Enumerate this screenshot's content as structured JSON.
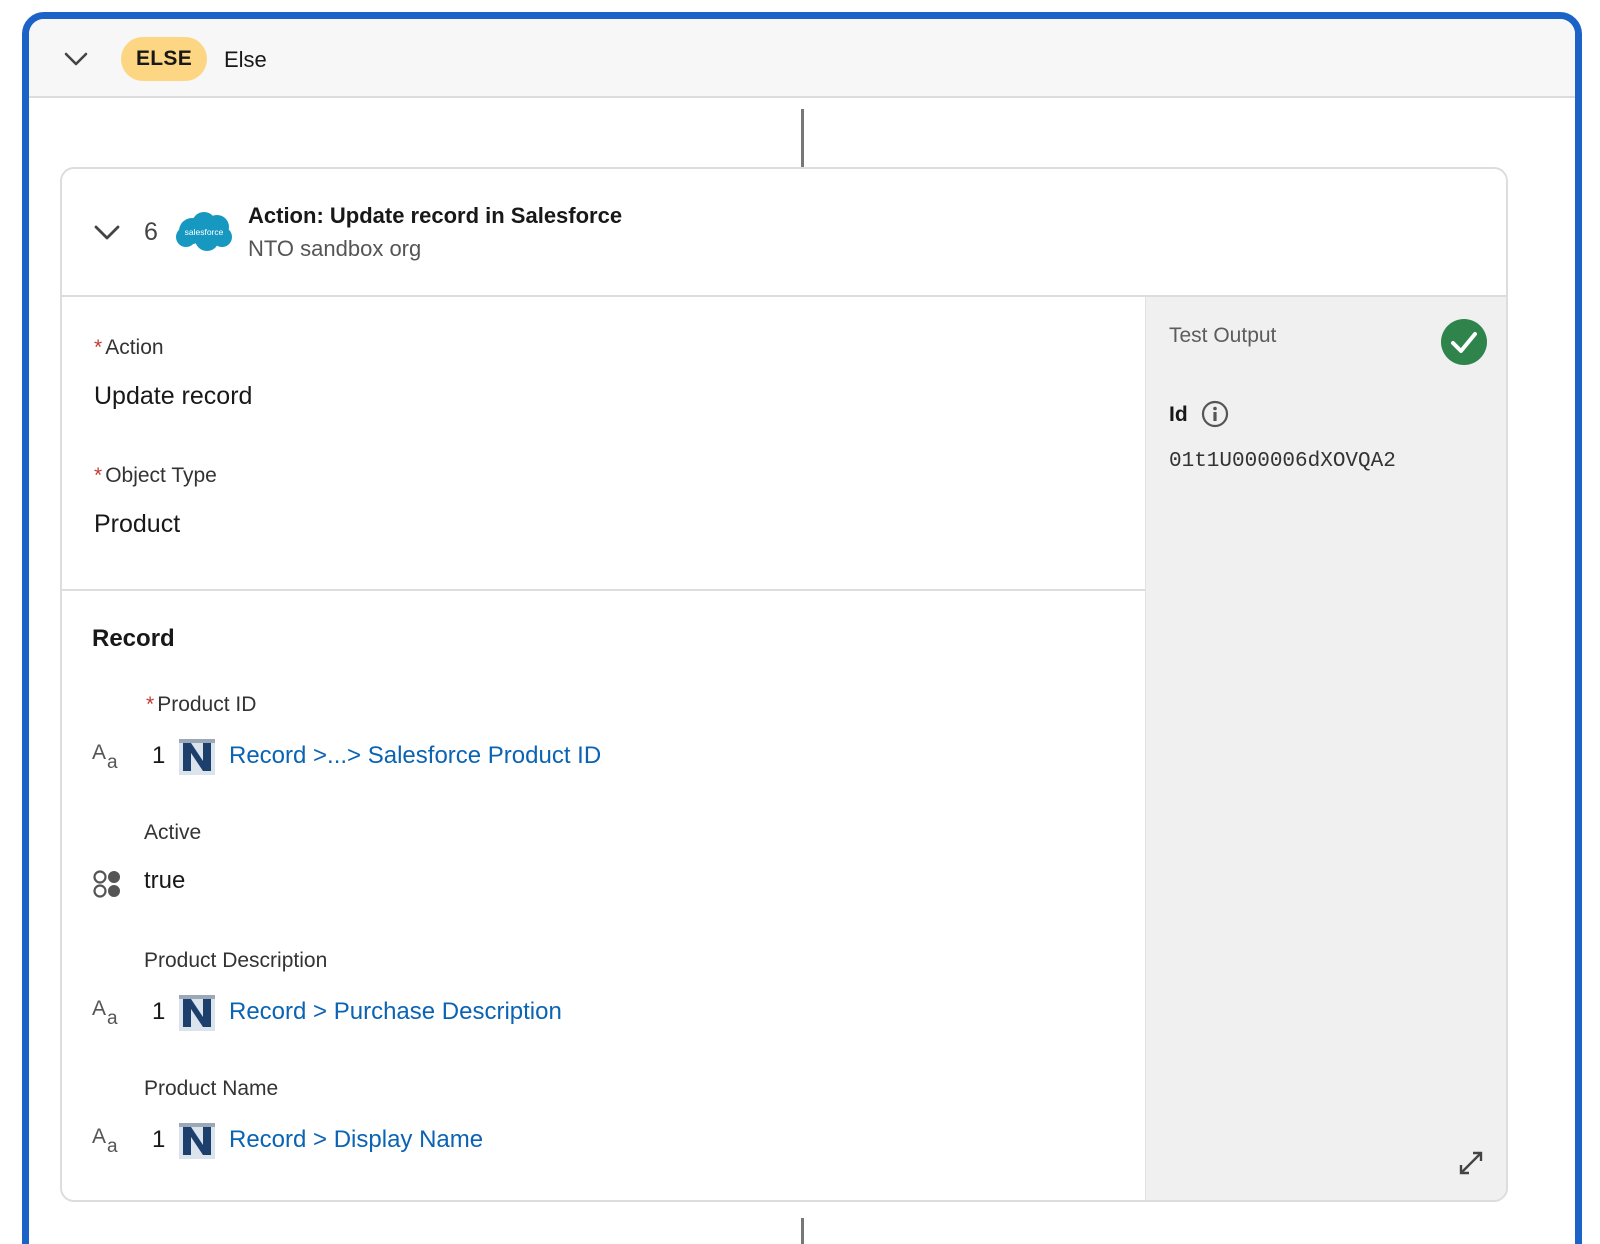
{
  "else_block": {
    "badge": "ELSE",
    "label": "Else"
  },
  "step": {
    "number": "6",
    "title": "Action: Update record in Salesforce",
    "subtitle": "NTO sandbox org",
    "logo_text": "salesforce"
  },
  "fields": {
    "action_label": "Action",
    "action_value": "Update record",
    "object_type_label": "Object Type",
    "object_type_value": "Product",
    "required_mark": "*"
  },
  "record": {
    "title": "Record",
    "rows": [
      {
        "label": "Product ID",
        "required": true,
        "type": "text",
        "index": "1",
        "value": "Record >...> Salesforce Product ID"
      },
      {
        "label": "Active",
        "required": false,
        "type": "picklist",
        "value": "true"
      },
      {
        "label": "Product Description",
        "required": false,
        "type": "text",
        "index": "1",
        "value": "Record > Purchase Description"
      },
      {
        "label": "Product Name",
        "required": false,
        "type": "text",
        "index": "1",
        "value": "Record > Display Name"
      }
    ]
  },
  "test_output": {
    "title": "Test Output",
    "status": "success",
    "key": "Id",
    "value": "01t1U000006dXOVQA2"
  },
  "colors": {
    "accent_border": "#1b63c6",
    "else_badge": "#fcd683",
    "link": "#0b63b3",
    "success": "#2e844a",
    "required": "#c23934"
  },
  "icons": {
    "text_type": "text-type-icon",
    "picklist_type": "picklist-type-icon",
    "source_logo": "netsuite-logo",
    "info": "info-icon",
    "expand": "expand-icon",
    "check": "check-circle-icon"
  }
}
